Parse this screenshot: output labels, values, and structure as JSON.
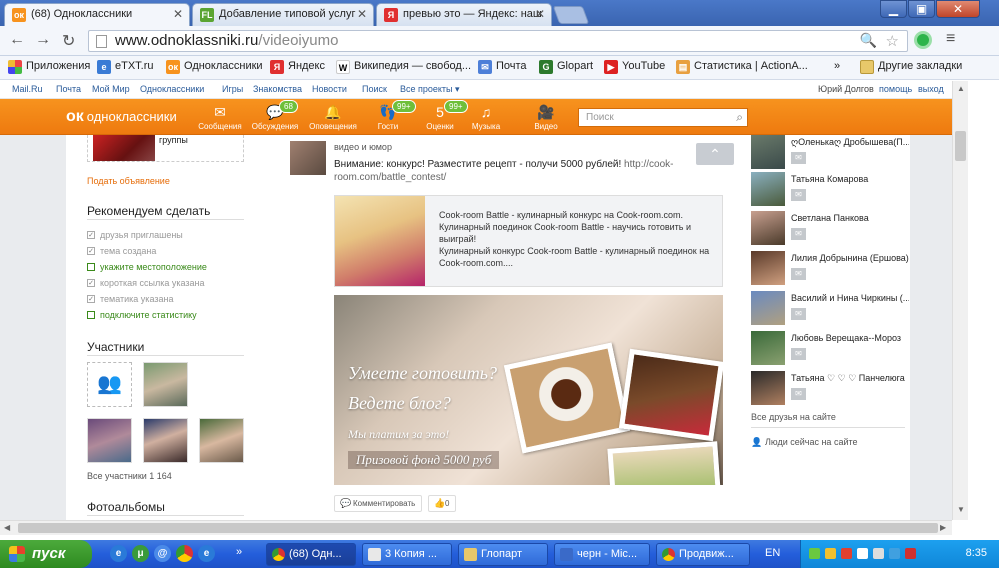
{
  "browser": {
    "tabs": [
      {
        "title": "(68) Одноклассники",
        "favicon": "ok-icon",
        "color": "#f7931e"
      },
      {
        "title": "Добавление типовой услуг",
        "favicon": "fl-icon",
        "color": "#5ba532"
      },
      {
        "title": "превью это — Яндекс: наш",
        "favicon": "yandex-icon",
        "color": "#e03030"
      }
    ],
    "url_host": "www.odnoklassniki.ru",
    "url_path": "/videoiyumo",
    "bookmarks": [
      "Приложения",
      "eTXT.ru",
      "Одноклассники",
      "Яндекс",
      "Википедия — свобод...",
      "Почта",
      "Glopart",
      "YouTube",
      "Статистика | ActionA...",
      "»",
      "Другие закладки"
    ]
  },
  "ok_topbar": {
    "links": [
      "Mail.Ru",
      "Почта",
      "Мой Мир",
      "Одноклассники",
      "Игры",
      "Знакомства",
      "Новости",
      "Поиск",
      "Все проекты ▾"
    ],
    "user": "Юрий Долгов",
    "help": "помощь",
    "logout": "выход"
  },
  "header": {
    "logo": "одноклассники",
    "nav": [
      {
        "label": "Сообщения",
        "icon": "✉",
        "badge": ""
      },
      {
        "label": "Обсуждения",
        "icon": "💬",
        "badge": "68"
      },
      {
        "label": "Оповещения",
        "icon": "🔔",
        "badge": ""
      },
      {
        "label": "Гости",
        "icon": "👣",
        "badge": "99+"
      },
      {
        "label": "Оценки",
        "icon": "5",
        "badge": "99+"
      },
      {
        "label": "Музыка",
        "icon": "♫",
        "badge": ""
      },
      {
        "label": "Видео",
        "icon": "🎥",
        "badge": ""
      }
    ],
    "search_placeholder": "Поиск"
  },
  "left": {
    "groups_label": "группы",
    "post_ad": "Подать объявление",
    "recommend_title": "Рекомендуем сделать",
    "recommend": [
      {
        "text": "друзья приглашены",
        "done": true
      },
      {
        "text": "тема создана",
        "done": true
      },
      {
        "text": "укажите местоположение",
        "done": false
      },
      {
        "text": "короткая ссылка указана",
        "done": true
      },
      {
        "text": "тематика указана",
        "done": true
      },
      {
        "text": "подключите статистику",
        "done": false
      }
    ],
    "members_title": "Участники",
    "all_members": "Все участники 1 164",
    "albums_title": "Фотоальбомы"
  },
  "post": {
    "group": "видео и юмор",
    "text": "Внимание: конкурс! Разместите рецепт - получи 5000 рублей!",
    "link": "http://cook-room.com/battle_contest/",
    "card_title": "Cook-room Battle - кулинарный конкурс на Cook-room.com. Кулинарный поединок Cook-room Battle - научись готовить и выиграй!",
    "card_desc": "Кулинарный конкурс Cook-room Battle - кулинарный поединок на Cook-room.com....",
    "banner_line1": "Умеете готовить?",
    "banner_line2": "Ведете блог?",
    "banner_line3": "Мы платим за это!",
    "banner_line4": "Призовой фонд 5000 руб",
    "comment_btn": "Комментировать",
    "like_count": "0"
  },
  "friends": [
    "ღОленькаღ Дробышева(П...",
    "Татьяна Комарова",
    "Светлана Панкова",
    "Лилия Добрынина (Ершова)",
    "Василий и Нина Чиркины (...",
    "Любовь Верещака--Мороз",
    "Татьяна ♡ ♡ ♡ Панчелюга"
  ],
  "friends_all": "Все друзья на сайте",
  "people_online": "Люди сейчас на сайте",
  "taskbar": {
    "start": "пуск",
    "items": [
      "(68) Одн...",
      "3 Копия ...",
      "Глопарт",
      "черн - Mic...",
      "Продвиж..."
    ],
    "lang": "EN",
    "time": "8:35"
  }
}
